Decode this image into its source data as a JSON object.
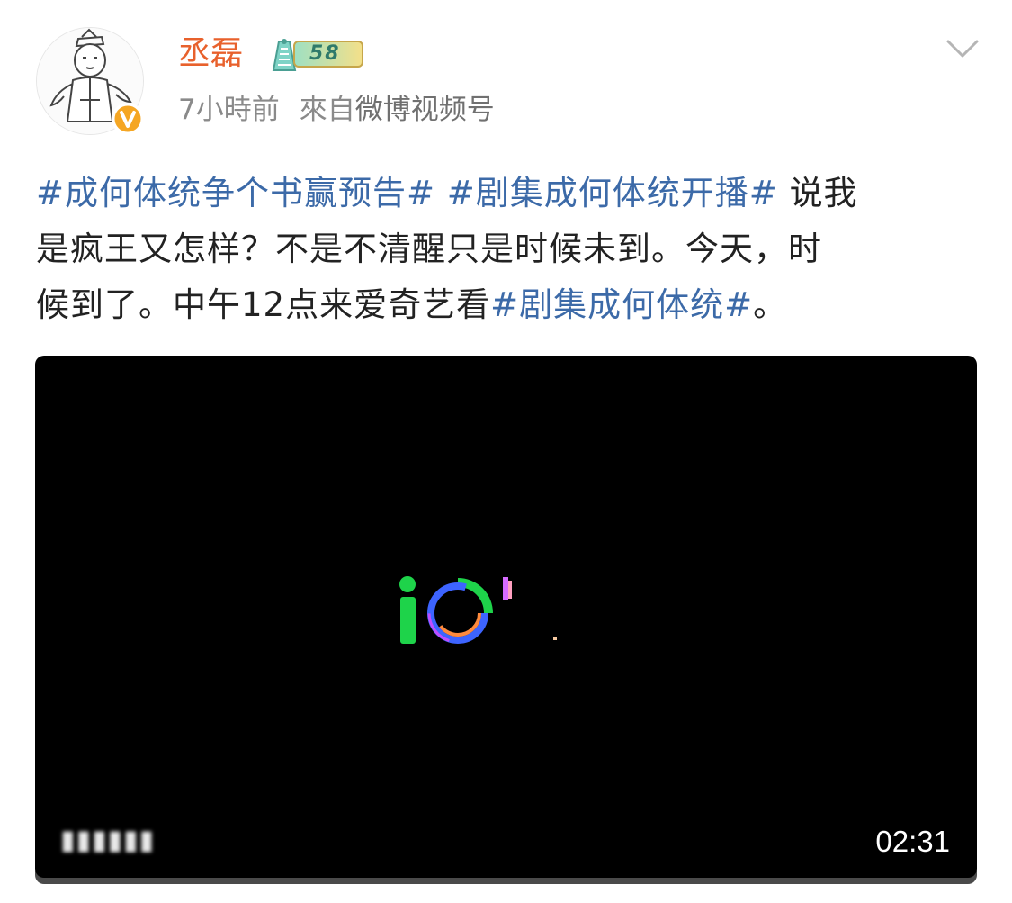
{
  "post": {
    "author": {
      "name": "丞磊",
      "level": "58",
      "verified": true
    },
    "time": "7小時前",
    "source_prefix": "來自",
    "source_app": "微博视频号",
    "text": {
      "hashtag_1": "#成何体统争个书赢预告#",
      "hashtag_2": "#剧集成何体统开播#",
      "line1_tail": "说我",
      "line2": "是疯王又怎样？不是不清醒只是时候未到。今天，时",
      "line3_head": "候到了。中午12点来爱奇艺看",
      "hashtag_3": "#剧集成何体统#",
      "line3_tail": "。"
    },
    "video": {
      "caption": "▮▮▮▮▮▮",
      "duration": "02:31",
      "logo_colors": {
        "green": "#1ed34a",
        "ring_blue": "#3d64ff",
        "ring_orange": "#ff8a3c",
        "ring_purple": "#c04dff",
        "dot_pink": "#d66bff"
      }
    }
  },
  "colors": {
    "username": "#e8612c",
    "hashtag": "#3c6aa8",
    "meta": "#8a8a8a",
    "video_bg": "#000000"
  },
  "icons": {
    "more": "chevron-down-icon",
    "verified": "verified-v-icon",
    "level": "level-badge-icon"
  }
}
